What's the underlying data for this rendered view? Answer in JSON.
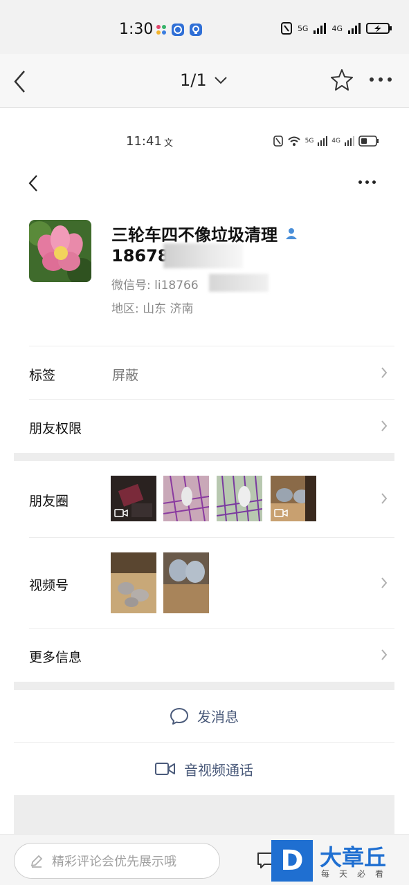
{
  "system_status": {
    "time": "1:30",
    "network_labels": [
      "5G",
      "4G"
    ]
  },
  "viewer": {
    "page_indicator": "1/1"
  },
  "inner_status": {
    "time": "11:41",
    "network_labels": [
      "5G",
      "4G"
    ]
  },
  "profile": {
    "name": "三轮车四不像垃圾清理",
    "phone_visible": "18678",
    "wechat_id_label": "微信号: ",
    "wechat_id_visible": "li18766",
    "region_label": "地区: ",
    "region_value": "山东  济南"
  },
  "rows": {
    "tags": {
      "label": "标签",
      "value": "屏蔽"
    },
    "friend_permissions": {
      "label": "朋友权限"
    },
    "moments": {
      "label": "朋友圈"
    },
    "channels": {
      "label": "视频号"
    },
    "more_info": {
      "label": "更多信息"
    }
  },
  "actions": {
    "send_message": "发消息",
    "av_call": "音视频通话"
  },
  "comment_bar": {
    "placeholder": "精彩评论会优先展示哦"
  },
  "watermark": {
    "logo_letter": "D",
    "brand": "大章丘",
    "slogan": "每天必看"
  },
  "colors": {
    "accent_blue": "#1f6fd1",
    "action_text": "#4a5a7a",
    "verified_icon": "#4a8fd9"
  }
}
